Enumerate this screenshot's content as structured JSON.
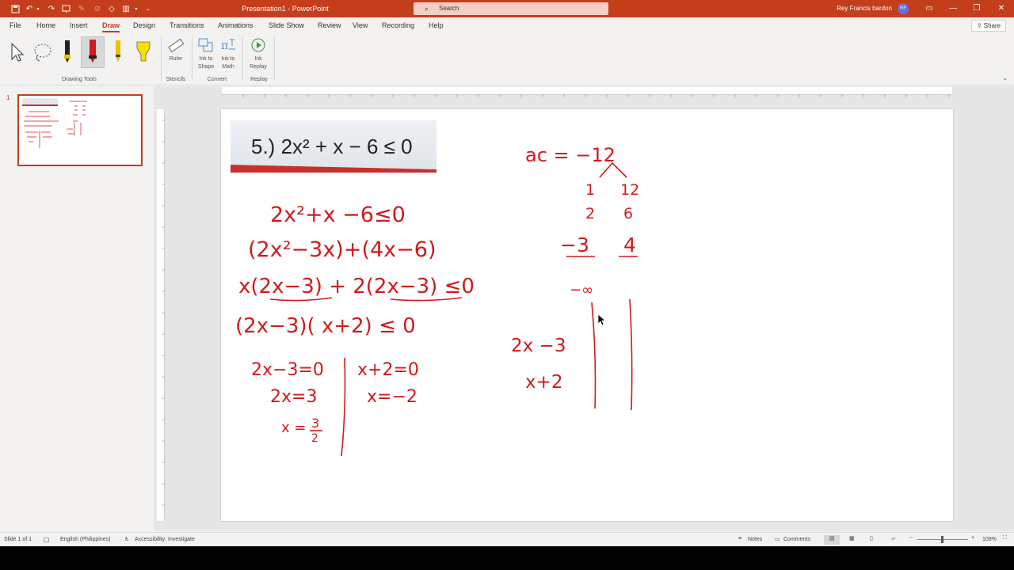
{
  "window": {
    "title": "Presentation1 - PowerPoint",
    "search_placeholder": "Search",
    "user_name": "Rey Francis bardon",
    "user_initials": "RF"
  },
  "ribbon_tabs": [
    "File",
    "Home",
    "Insert",
    "Draw",
    "Design",
    "Transitions",
    "Animations",
    "Slide Show",
    "Review",
    "View",
    "Recording",
    "Help"
  ],
  "active_tab": "Draw",
  "share_label": "Share",
  "ribbon": {
    "groups": {
      "drawing_tools": "Drawing Tools",
      "stencils": "Stencils",
      "convert": "Convert",
      "replay": "Replay"
    },
    "buttons": {
      "ruler": "Ruler",
      "ink_to_shape_1": "Ink to",
      "ink_to_shape_2": "Shape",
      "ink_to_math_1": "Ink to",
      "ink_to_math_2": "Math",
      "ink_replay_1": "Ink",
      "ink_replay_2": "Replay"
    }
  },
  "thumbnail": {
    "number": "1"
  },
  "slide": {
    "banner": "5.) 2x² + x − 6 ≤ 0",
    "left_work": {
      "line1": "2x²+x −6≤0",
      "line2": "(2x²−3x)+(4x−6)",
      "line3": "x(2x−3) + 2(2x−3) ≤0",
      "line4": "(2x−3)( x+2) ≤ 0",
      "line5a": "2x−3=0",
      "line5b": "x+2=0",
      "line6a": "2x=3",
      "line6b": "x=−2",
      "line7": "x =",
      "frac_num": "3",
      "frac_den": "2"
    },
    "right_work": {
      "ac": "ac = −12",
      "f1a": "1",
      "f1b": "12",
      "f2a": "2",
      "f2b": "6",
      "f3a": "−3",
      "f3b": "4",
      "neg_inf": "−∞",
      "row1": "2x −3",
      "row2": "x+2"
    }
  },
  "status": {
    "slide_info": "Slide 1 of 1",
    "language": "English (Philippines)",
    "accessibility": "Accessibility: Investigate",
    "notes": "Notes",
    "comments": "Comments",
    "zoom": "109%"
  },
  "colors": {
    "accent": "#c43e1c",
    "ink": "#d11a1a"
  }
}
